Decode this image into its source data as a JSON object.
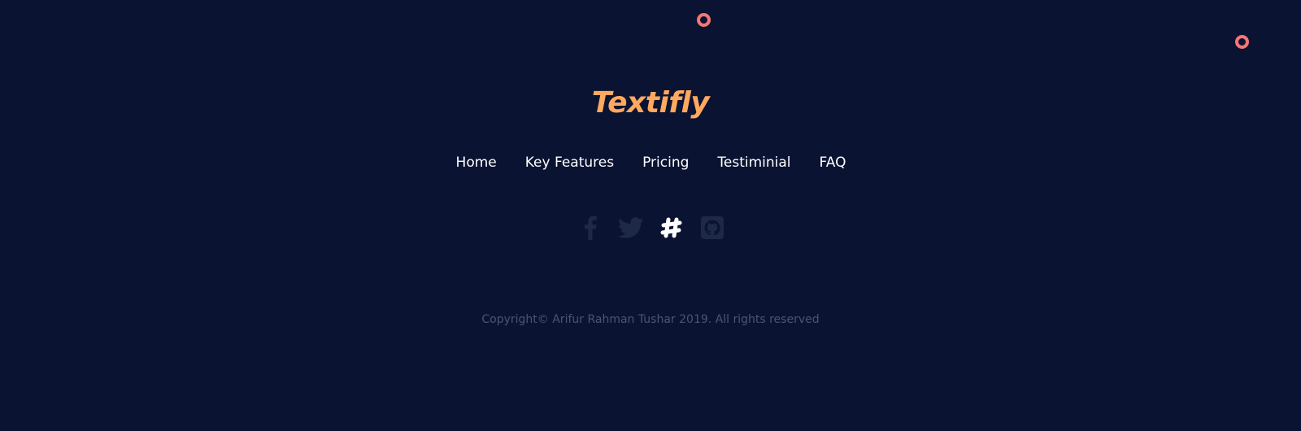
{
  "brand": {
    "name": "Textifly",
    "color": "#ffa95e"
  },
  "nav": {
    "items": [
      {
        "label": "Home"
      },
      {
        "label": "Key Features"
      },
      {
        "label": "Pricing"
      },
      {
        "label": "Testiminial"
      },
      {
        "label": "FAQ"
      }
    ]
  },
  "social": {
    "icons": [
      {
        "name": "facebook-icon",
        "color": "#1e2945"
      },
      {
        "name": "twitter-icon",
        "color": "#1e2945"
      },
      {
        "name": "slack-icon",
        "color": "#ffffff"
      },
      {
        "name": "github-icon",
        "color": "#1e2945"
      }
    ]
  },
  "copyright": {
    "text": "Copyright© Arifur Rahman Tushar 2019. All rights reserved"
  },
  "colors": {
    "background": "#0a1332",
    "accent_ring": "#f57676",
    "muted_text": "#4b5573"
  }
}
